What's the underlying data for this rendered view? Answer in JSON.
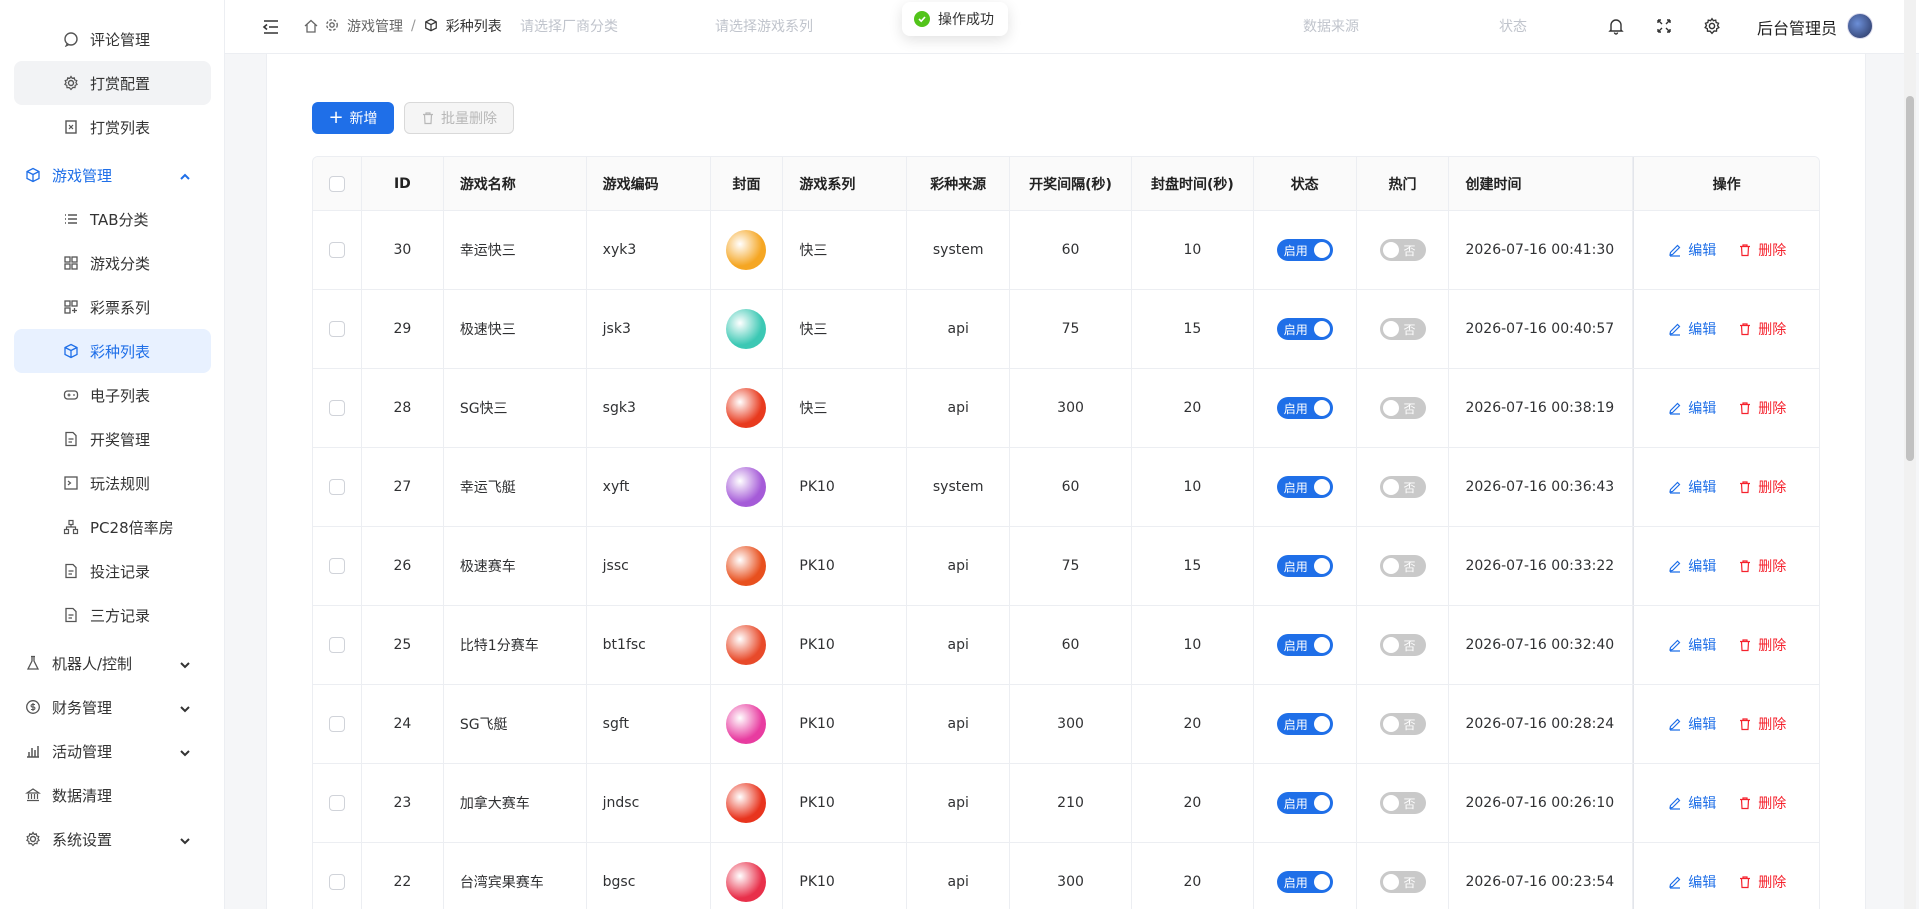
{
  "sidebar": {
    "items": [
      {
        "label": "评论管理",
        "icon": "comment-icon",
        "kind": "sub"
      },
      {
        "label": "打赏配置",
        "icon": "gear-icon",
        "kind": "sub"
      },
      {
        "label": "打赏列表",
        "icon": "list-doc-icon",
        "kind": "sub"
      },
      {
        "label": "游戏管理",
        "icon": "cube-icon",
        "kind": "top"
      },
      {
        "label": "TAB分类",
        "icon": "list-icon",
        "kind": "sub"
      },
      {
        "label": "游戏分类",
        "icon": "grid-icon",
        "kind": "sub"
      },
      {
        "label": "彩票系列",
        "icon": "grid-plus-icon",
        "kind": "sub"
      },
      {
        "label": "彩种列表",
        "icon": "cube-icon",
        "kind": "sub"
      },
      {
        "label": "电子列表",
        "icon": "gamepad-icon",
        "kind": "sub"
      },
      {
        "label": "开奖管理",
        "icon": "doc-icon",
        "kind": "sub"
      },
      {
        "label": "玩法规则",
        "icon": "terminal-icon",
        "kind": "sub"
      },
      {
        "label": "PC28倍率房",
        "icon": "tree-icon",
        "kind": "sub"
      },
      {
        "label": "投注记录",
        "icon": "doc-icon",
        "kind": "sub"
      },
      {
        "label": "三方记录",
        "icon": "doc-icon",
        "kind": "sub"
      },
      {
        "label": "机器人/控制",
        "icon": "flask-icon",
        "kind": "top"
      },
      {
        "label": "财务管理",
        "icon": "dollar-icon",
        "kind": "top"
      },
      {
        "label": "活动管理",
        "icon": "chart-icon",
        "kind": "top"
      },
      {
        "label": "数据清理",
        "icon": "bank-icon",
        "kind": "top"
      },
      {
        "label": "系统设置",
        "icon": "gear-icon",
        "kind": "top"
      }
    ]
  },
  "header": {
    "breadcrumb": [
      "游戏管理",
      "彩种列表"
    ],
    "ghost_filters": [
      "请选择厂商分类",
      "请选择游戏系列",
      "数据来源",
      "状态"
    ],
    "admin_name": "后台管理员"
  },
  "toast": {
    "message": "操作成功"
  },
  "toolbar": {
    "add_label": "新增",
    "batch_delete_label": "批量删除"
  },
  "table": {
    "columns": [
      "ID",
      "游戏名称",
      "游戏编码",
      "封面",
      "游戏系列",
      "彩种来源",
      "开奖间隔(秒)",
      "封盘时间(秒)",
      "状态",
      "热门",
      "创建时间",
      "操作"
    ],
    "status_on_label": "启用",
    "hot_off_label": "否",
    "edit_label": "编辑",
    "delete_label": "删除",
    "rows": [
      {
        "id": "30",
        "name": "幸运快三",
        "code": "xyk3",
        "series": "快三",
        "source": "system",
        "interval": "60",
        "close": "10",
        "created": "2026-07-16 00:41:30",
        "cover_color": "#f5a623"
      },
      {
        "id": "29",
        "name": "极速快三",
        "code": "jsk3",
        "series": "快三",
        "source": "api",
        "interval": "75",
        "close": "15",
        "created": "2026-07-16 00:40:57",
        "cover_color": "#3cc8b4"
      },
      {
        "id": "28",
        "name": "SG快三",
        "code": "sgk3",
        "series": "快三",
        "source": "api",
        "interval": "300",
        "close": "20",
        "created": "2026-07-16 00:38:19",
        "cover_color": "#e83a1e"
      },
      {
        "id": "27",
        "name": "幸运飞艇",
        "code": "xyft",
        "series": "PK10",
        "source": "system",
        "interval": "60",
        "close": "10",
        "created": "2026-07-16 00:36:43",
        "cover_color": "#a55bd8"
      },
      {
        "id": "26",
        "name": "极速赛车",
        "code": "jssc",
        "series": "PK10",
        "source": "api",
        "interval": "75",
        "close": "15",
        "created": "2026-07-16 00:33:22",
        "cover_color": "#e8501e"
      },
      {
        "id": "25",
        "name": "比特1分赛车",
        "code": "bt1fsc",
        "series": "PK10",
        "source": "api",
        "interval": "60",
        "close": "10",
        "created": "2026-07-16 00:32:40",
        "cover_color": "#e84a2a"
      },
      {
        "id": "24",
        "name": "SG飞艇",
        "code": "sgft",
        "series": "PK10",
        "source": "api",
        "interval": "300",
        "close": "20",
        "created": "2026-07-16 00:28:24",
        "cover_color": "#e83ca0"
      },
      {
        "id": "23",
        "name": "加拿大赛车",
        "code": "jndsc",
        "series": "PK10",
        "source": "api",
        "interval": "210",
        "close": "20",
        "created": "2026-07-16 00:26:10",
        "cover_color": "#e8341e"
      },
      {
        "id": "22",
        "name": "台湾宾果赛车",
        "code": "bgsc",
        "series": "PK10",
        "source": "api",
        "interval": "300",
        "close": "20",
        "created": "2026-07-16 00:23:54",
        "cover_color": "#e8304a"
      }
    ]
  }
}
